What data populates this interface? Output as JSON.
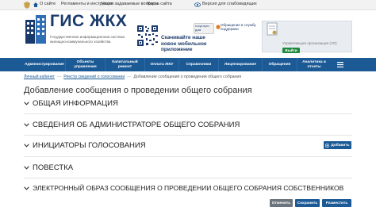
{
  "topbar": {
    "about": "О сайте",
    "regulations": "Регламенты и инструкции",
    "faq": "Часто задаваемые вопросы",
    "sitemap": "Карта сайта",
    "accessibility": "Версия для слабовидящих"
  },
  "header": {
    "logo_title": "ГИС ЖКХ",
    "logo_subtitle": "Государственная информационная система жилищно-коммунального хозяйства",
    "app_promo": "Скачивайте наше новое мобильное приложение",
    "phone_promo": "госуслуги дом",
    "support": "Обращение в службу поддержки",
    "org_label": "Управляющая организация (УО)",
    "login_button": "Выйти"
  },
  "nav": {
    "items": [
      "Администрирование",
      "Объекты управления",
      "Капитальный ремонт",
      "Оплата ЖКУ",
      "Справочники",
      "Лицензирование",
      "Обращения",
      "Аналитика и отчеты"
    ]
  },
  "breadcrumb": {
    "home": "Личный кабинет",
    "registry": "Реестр сведений о голосовании",
    "current": "Добавление сообщения о проведении общего собрания"
  },
  "page": {
    "title": "Добавление сообщения о проведении общего собрания"
  },
  "sections": [
    "ОБЩАЯ ИНФОРМАЦИЯ",
    "СВЕДЕНИЯ ОБ АДМИНИСТРАТОРЕ ОБЩЕГО СОБРАНИЯ",
    "ИНИЦИАТОРЫ ГОЛОСОВАНИЯ",
    "ПОВЕСТКА",
    "ЭЛЕКТРОННЫЙ ОБРАЗ СООБЩЕНИЯ О ПРОВЕДЕНИИ ОБЩЕГО СОБРАНИЯ СОБСТВЕННИКОВ"
  ],
  "actions": {
    "add": "Добавить",
    "cancel": "Отменить",
    "save": "Сохранить",
    "publish": "Разместить"
  },
  "colors": {
    "nav": "#1c5a96",
    "brand": "#1a3a6b",
    "cancel": "#6c757d",
    "primary": "#1c5a96"
  }
}
